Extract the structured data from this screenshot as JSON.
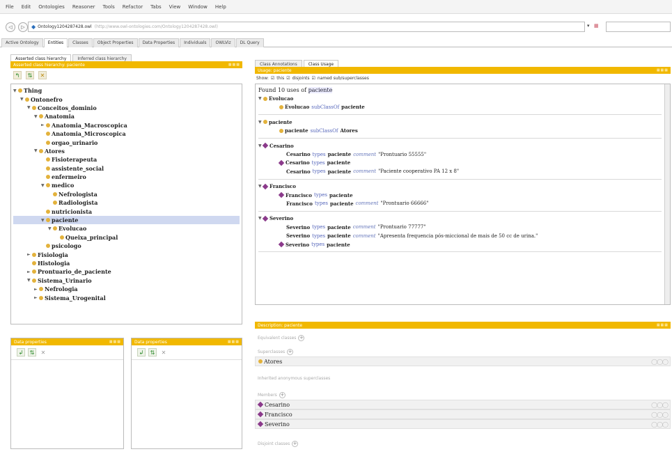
{
  "menu": [
    "File",
    "Edit",
    "Ontologies",
    "Reasoner",
    "Tools",
    "Refactor",
    "Tabs",
    "View",
    "Window",
    "Help"
  ],
  "address": {
    "ontology": "Ontology1204287428.owl",
    "url": "(http://www.owl-ontologies.com/Ontology1204287428.owl)"
  },
  "tabs": [
    "Active Ontology",
    "Entities",
    "Classes",
    "Object Properties",
    "Data Properties",
    "Individuals",
    "OWLViz",
    "DL Query"
  ],
  "left": {
    "subtabs": [
      "Asserted class hierarchy",
      "Inferred class hierarchy"
    ],
    "header": "Asserted class hierarchy: paciente",
    "tree": [
      {
        "label": "Thing",
        "indent": 0,
        "tog": "▼",
        "bold": true
      },
      {
        "label": "Ontonefro",
        "indent": 1,
        "tog": "▼",
        "bold": true
      },
      {
        "label": "Conceitos_dominio",
        "indent": 2,
        "tog": "▼",
        "bold": true
      },
      {
        "label": "Anatomia",
        "indent": 3,
        "tog": "▼",
        "bold": true
      },
      {
        "label": "Anatomia_Macroscopica",
        "indent": 4,
        "tog": "►",
        "bold": true
      },
      {
        "label": "Anatomia_Microscopica",
        "indent": 4,
        "tog": "",
        "bold": true
      },
      {
        "label": "orgao_urinario",
        "indent": 4,
        "tog": "",
        "bold": true
      },
      {
        "label": "Atores",
        "indent": 3,
        "tog": "▼",
        "bold": true
      },
      {
        "label": "Fisioterapeuta",
        "indent": 4,
        "tog": "",
        "bold": true
      },
      {
        "label": "assistente_social",
        "indent": 4,
        "tog": "",
        "bold": true
      },
      {
        "label": "enfermeiro",
        "indent": 4,
        "tog": "",
        "bold": true
      },
      {
        "label": "medico",
        "indent": 4,
        "tog": "▼",
        "bold": true
      },
      {
        "label": "Nefrologista",
        "indent": 5,
        "tog": "",
        "bold": true
      },
      {
        "label": "Radiologista",
        "indent": 5,
        "tog": "",
        "bold": true
      },
      {
        "label": "nutricionista",
        "indent": 4,
        "tog": "",
        "bold": true
      },
      {
        "label": "paciente",
        "indent": 4,
        "tog": "▼",
        "bold": true,
        "selected": true
      },
      {
        "label": "Evolucao",
        "indent": 5,
        "tog": "▼",
        "bold": true
      },
      {
        "label": "Queixa_principal",
        "indent": 6,
        "tog": "",
        "bold": true
      },
      {
        "label": "psicologo",
        "indent": 4,
        "tog": "",
        "bold": true
      },
      {
        "label": "Fisiologia",
        "indent": 2,
        "tog": "►",
        "bold": true
      },
      {
        "label": "Histologia",
        "indent": 2,
        "tog": "",
        "bold": true
      },
      {
        "label": "Prontuario_de_paciente",
        "indent": 2,
        "tog": "►",
        "bold": true
      },
      {
        "label": "Sistema_Urinario",
        "indent": 2,
        "tog": "▼",
        "bold": true
      },
      {
        "label": "Nefrologia",
        "indent": 3,
        "tog": "►",
        "bold": true
      },
      {
        "label": "Sistema_Urogenital",
        "indent": 3,
        "tog": "►",
        "bold": true
      }
    ]
  },
  "lower_left": {
    "header": "Data properties"
  },
  "lower_mid": {
    "header": "Data properties"
  },
  "right": {
    "subtabs": [
      "Class Annotations",
      "Class Usage"
    ],
    "header": "Usage: paciente",
    "show_label": "Show:",
    "show_this": "this",
    "show_disjoints": "disjoints",
    "show_named": "named sub/superclasses",
    "found": "Found 10 uses of",
    "found_entity": "paciente",
    "blocks": [
      {
        "entity": "Evolucao",
        "kind": "class",
        "lines": [
          {
            "kind": "class",
            "subject": "Evolucao",
            "pred": "subClassOf",
            "object": "paciente"
          }
        ]
      },
      {
        "entity": "paciente",
        "kind": "class",
        "lines": [
          {
            "kind": "class",
            "subject": "paciente",
            "pred": "subClassOf",
            "object": "Atores"
          }
        ]
      },
      {
        "entity": "Cesarino",
        "kind": "ind",
        "lines": [
          {
            "kind": "",
            "subject": "Cesarino",
            "pred": "types",
            "object": "paciente",
            "ann": "comment",
            "lit": "\"Prontuario 55555\""
          },
          {
            "kind": "ind",
            "subject": "Cesarino",
            "pred": "types",
            "object": "paciente"
          },
          {
            "kind": "",
            "subject": "Cesarino",
            "pred": "types",
            "object": "paciente",
            "ann": "comment",
            "lit": "\"Paciente cooperativo PA 12 x 8\""
          }
        ]
      },
      {
        "entity": "Francisco",
        "kind": "ind",
        "lines": [
          {
            "kind": "ind",
            "subject": "Francisco",
            "pred": "types",
            "object": "paciente"
          },
          {
            "kind": "",
            "subject": "Francisco",
            "pred": "types",
            "object": "paciente",
            "ann": "comment",
            "lit": "\"Prontuario 66666\""
          }
        ]
      },
      {
        "entity": "Severino",
        "kind": "ind",
        "lines": [
          {
            "kind": "",
            "subject": "Severino",
            "pred": "types",
            "object": "paciente",
            "ann": "comment",
            "lit": "\"Prontuario 77777\""
          },
          {
            "kind": "",
            "subject": "Severino",
            "pred": "types",
            "object": "paciente",
            "ann": "comment",
            "lit": "\"Apresenta frequencia pós-miccional de mais de 50 cc de urina.\""
          },
          {
            "kind": "ind",
            "subject": "Severino",
            "pred": "types",
            "object": "paciente"
          }
        ]
      }
    ]
  },
  "description": {
    "header": "Description: paciente",
    "equivalent": "Equivalent classes",
    "superclasses": "Superclasses",
    "superclass_items": [
      "Atores"
    ],
    "inherited": "Inherited anonymous superclasses",
    "members": "Members",
    "member_items": [
      "Cesarino",
      "Francisco",
      "Severino"
    ],
    "disjoint": "Disjoint classes"
  },
  "colors": {
    "accent": "#f1b800",
    "individual": "#8b3a8b",
    "class": "#e3b23c"
  }
}
